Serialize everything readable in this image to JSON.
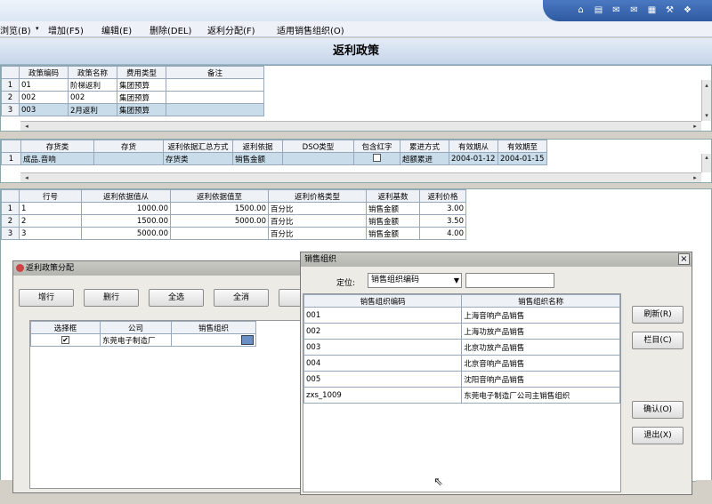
{
  "menu": [
    {
      "label": "浏览(B)"
    },
    {
      "label": "增加(F5)"
    },
    {
      "label": "编辑(E)"
    },
    {
      "label": "删除(DEL)"
    },
    {
      "label": "返利分配(F)"
    },
    {
      "label": "适用销售组织(O)"
    }
  ],
  "page_title": "返利政策",
  "policy_grid": {
    "headers": [
      "政策编码",
      "政策名称",
      "费用类型",
      "备注"
    ],
    "rows": [
      {
        "rn": "1",
        "cells": [
          "01",
          "阶梯返利",
          "集团预算",
          ""
        ]
      },
      {
        "rn": "2",
        "cells": [
          "002",
          "002",
          "集团预算",
          ""
        ]
      },
      {
        "rn": "3",
        "cells": [
          "003",
          "2月返利",
          "集团预算",
          ""
        ]
      }
    ]
  },
  "inventory_grid": {
    "headers": [
      "存货类",
      "存货",
      "返利依据汇总方式",
      "返利依据",
      "DSO类型",
      "包含红字",
      "累进方式",
      "有效期从",
      "有效期至"
    ],
    "rows": [
      {
        "rn": "1",
        "cells": [
          "成品.音响",
          "",
          "存货类",
          "销售金额",
          "",
          "",
          "超额累进",
          "2004-01-12",
          "2004-01-15"
        ]
      }
    ]
  },
  "price_grid": {
    "headers": [
      "行号",
      "返利依据值从",
      "返利依据值至",
      "返利价格类型",
      "返利基数",
      "返利价格"
    ],
    "rows": [
      {
        "rn": "1",
        "cells": [
          "1",
          "1000.00",
          "1500.00",
          "百分比",
          "销售金额",
          "3.00"
        ]
      },
      {
        "rn": "2",
        "cells": [
          "2",
          "1500.00",
          "5000.00",
          "百分比",
          "销售金额",
          "3.50"
        ]
      },
      {
        "rn": "3",
        "cells": [
          "3",
          "5000.00",
          "",
          "百分比",
          "销售金额",
          "4.00"
        ]
      }
    ]
  },
  "assign_dialog": {
    "title": "返利政策分配",
    "buttons": [
      "增行",
      "删行",
      "全选",
      "全消"
    ],
    "grid_headers": [
      "选择框",
      "公司",
      "销售组织"
    ],
    "rows": [
      {
        "checked": "✔",
        "company": "东莞电子制造厂",
        "org": ""
      }
    ]
  },
  "org_dialog": {
    "title": "销售组织",
    "locate_label": "定位:",
    "locate_select": "销售组织编码",
    "locate_value": "",
    "grid_headers": [
      "销售组织编码",
      "销售组织名称"
    ],
    "rows": [
      {
        "code": "001",
        "name": "上海音响产品销售"
      },
      {
        "code": "002",
        "name": "上海功放产品销售"
      },
      {
        "code": "003",
        "name": "北京功放产品销售"
      },
      {
        "code": "004",
        "name": "北京音响产品销售"
      },
      {
        "code": "005",
        "name": "沈阳音响产品销售"
      },
      {
        "code": "zxs_1009",
        "name": "东莞电子制造厂公司主销售组织"
      }
    ],
    "buttons": {
      "refresh": "刷新(R)",
      "columns": "栏目(C)",
      "confirm": "确认(O)",
      "exit": "退出(X)"
    }
  }
}
